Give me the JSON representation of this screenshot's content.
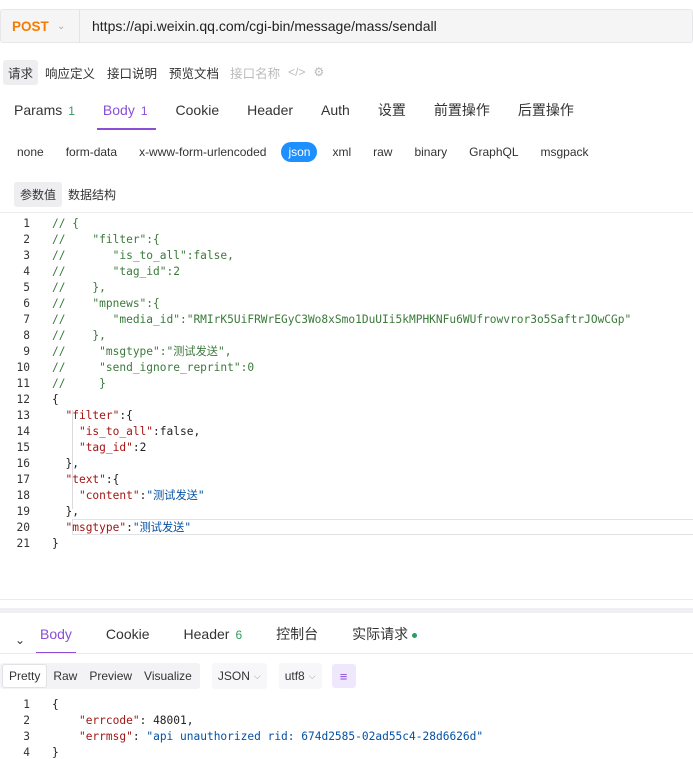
{
  "url_bar": {
    "method": "POST",
    "url": "https://api.weixin.qq.com/cgi-bin/message/mass/sendall"
  },
  "doc_tabs": [
    "请求",
    "响应定义",
    "接口说明",
    "预览文档"
  ],
  "doc_name_placeholder": "接口名称",
  "main_tabs": [
    {
      "label": "Params",
      "count": "1"
    },
    {
      "label": "Body",
      "count": "1"
    },
    {
      "label": "Cookie",
      "count": ""
    },
    {
      "label": "Header",
      "count": ""
    },
    {
      "label": "Auth",
      "count": ""
    },
    {
      "label": "设置",
      "count": ""
    },
    {
      "label": "前置操作",
      "count": ""
    },
    {
      "label": "后置操作",
      "count": ""
    }
  ],
  "body_types": [
    "none",
    "form-data",
    "x-www-form-urlencoded",
    "json",
    "xml",
    "raw",
    "binary",
    "GraphQL",
    "msgpack"
  ],
  "body_type_selected": "json",
  "param_tabs": [
    "参数值",
    "数据结构"
  ],
  "request_code": [
    "// {",
    "//    \"filter\":{",
    "//       \"is_to_all\":false,",
    "//       \"tag_id\":2",
    "//    },",
    "//    \"mpnews\":{",
    "//       \"media_id\":\"RMIrK5UiFRWrEGyC3Wo8xSmo1DuUIi5kMPHKNFu6WUfrowvror3o5SaftrJOwCGp\"",
    "//    },",
    "//     \"msgtype\":\"测试发送\",",
    "//     \"send_ignore_reprint\":0",
    "//     }",
    "{",
    "  \"filter\":{",
    "    \"is_to_all\":false,",
    "    \"tag_id\":2",
    "  },",
    "  \"text\":{",
    "    \"content\":\"测试发送\"",
    "  },",
    "  \"msgtype\":\"测试发送\"",
    "}"
  ],
  "response_tabs": [
    {
      "label": "Body",
      "count": ""
    },
    {
      "label": "Cookie",
      "count": ""
    },
    {
      "label": "Header",
      "count": "6"
    },
    {
      "label": "控制台",
      "count": ""
    },
    {
      "label": "实际请求",
      "count": ""
    }
  ],
  "format_tabs": [
    "Pretty",
    "Raw",
    "Preview",
    "Visualize"
  ],
  "format_selected": "Pretty",
  "response_format": "JSON",
  "response_encoding": "utf8",
  "response_code": [
    "{",
    "    \"errcode\": 48001,",
    "    \"errmsg\": \"api unauthorized rid: 674d2585-02ad55c4-28d6626d\"",
    "}"
  ],
  "colors": {
    "accent": "#8a4fd6",
    "method": "#f57c00",
    "count": "#2e9b61",
    "json_pill": "#1e8fff"
  }
}
